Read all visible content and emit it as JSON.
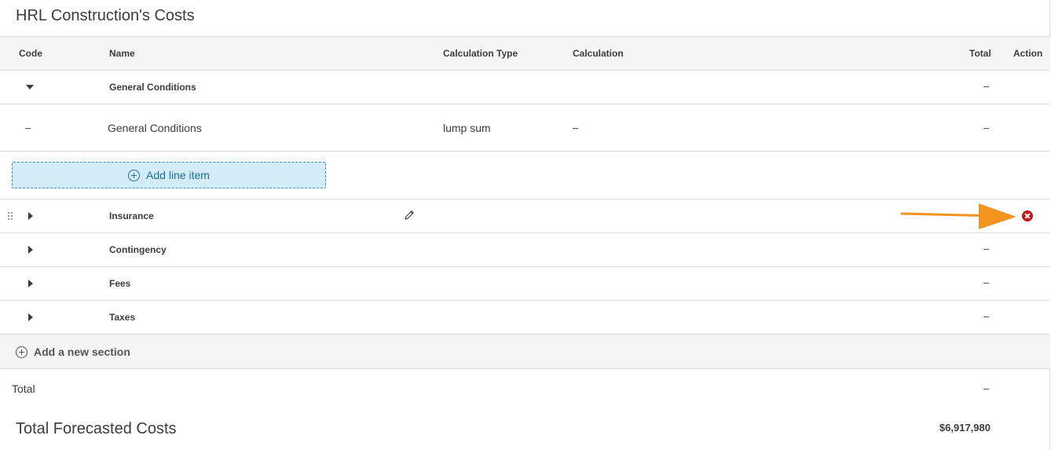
{
  "page": {
    "title": "HRL Construction's Costs"
  },
  "columns": {
    "code": "Code",
    "name": "Name",
    "calc_type": "Calculation Type",
    "calculation": "Calculation",
    "total": "Total",
    "action": "Action"
  },
  "sections": [
    {
      "name": "General Conditions",
      "expanded": true,
      "total": "–",
      "line_items": [
        {
          "code": "–",
          "name": "General Conditions",
          "calc_type": "lump sum",
          "calculation": "–",
          "total": "–"
        }
      ],
      "add_line_item_label": "Add line item"
    },
    {
      "name": "Insurance",
      "expanded": false,
      "total": ""
    },
    {
      "name": "Contingency",
      "expanded": false,
      "total": "–"
    },
    {
      "name": "Fees",
      "expanded": false,
      "total": "–"
    },
    {
      "name": "Taxes",
      "expanded": false,
      "total": "–"
    }
  ],
  "add_section_label": "Add a new section",
  "totals": {
    "total_label": "Total",
    "total_value": "–",
    "forecast_label": "Total Forecasted Costs",
    "forecast_value": "$6,917,980"
  },
  "colors": {
    "accent": "#1c6ea4",
    "add_bg": "#d3ecf7",
    "remove": "#c4161c",
    "arrow": "#f39320"
  },
  "icons": [
    "caret-down-icon",
    "caret-right-icon",
    "plus-circle-icon",
    "pencil-icon",
    "remove-icon",
    "drag-handle-icon",
    "arrow-annotation"
  ]
}
